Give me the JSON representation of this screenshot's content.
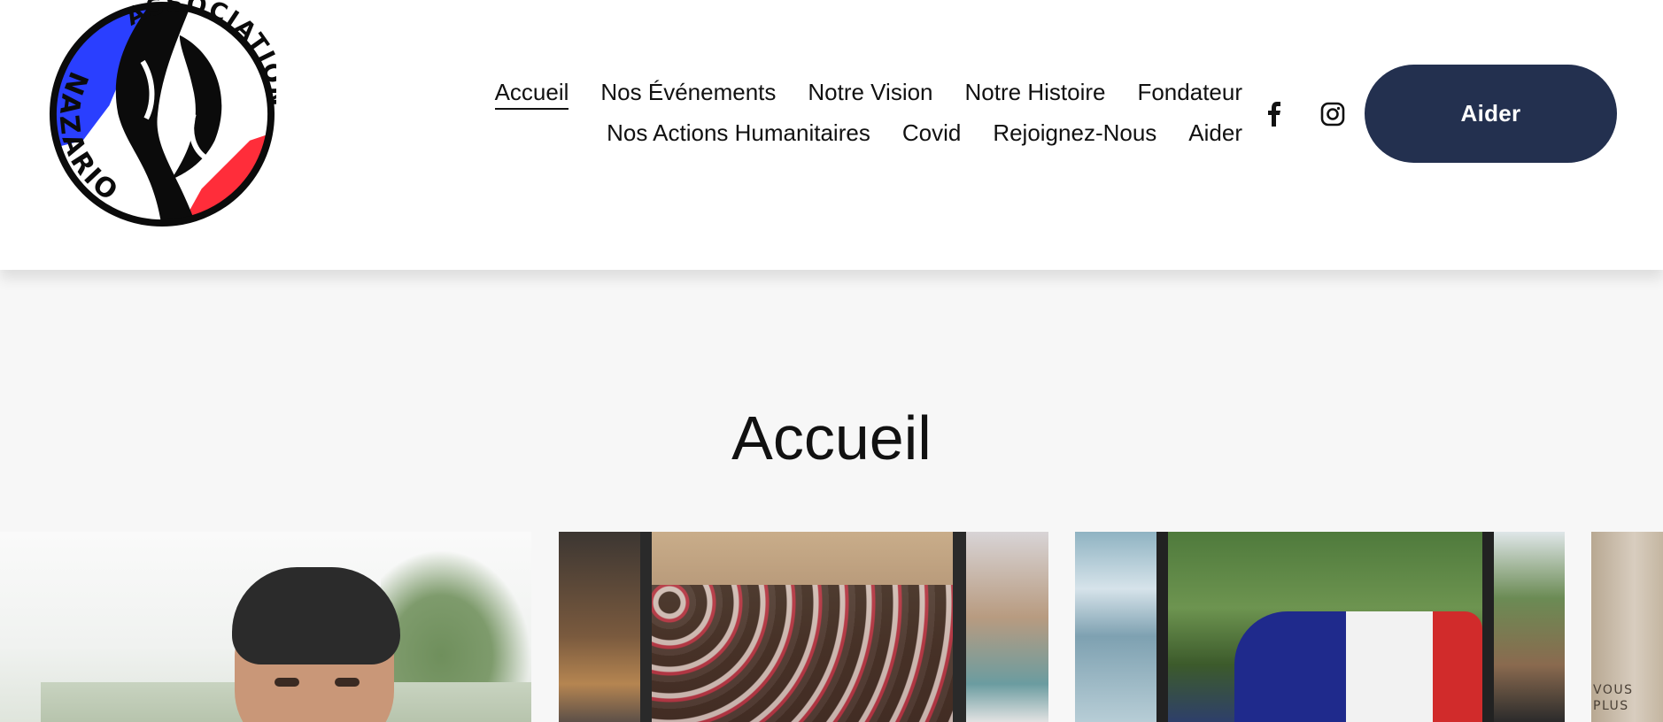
{
  "brand": {
    "logo_text_top": "ASSOCIATION",
    "logo_text_bottom": "NAZARIO",
    "colors": {
      "blue": "#2a3fff",
      "red": "#ff2d3a",
      "black": "#0b0b0b"
    }
  },
  "nav": {
    "row1": [
      "Accueil",
      "Nos Événements",
      "Notre Vision",
      "Notre Histoire",
      "Fondateur"
    ],
    "row2": [
      "Nos Actions Humanitaires",
      "Covid",
      "Rejoignez-Nous",
      "Aider"
    ],
    "active": "Accueil"
  },
  "social": {
    "facebook": "facebook-icon",
    "instagram": "instagram-icon"
  },
  "cta": {
    "label": "Aider",
    "color": "#23304f"
  },
  "main": {
    "title": "Accueil"
  },
  "gallery": {
    "partial_caption_lines": [
      "VOUS",
      "PLUS"
    ]
  }
}
